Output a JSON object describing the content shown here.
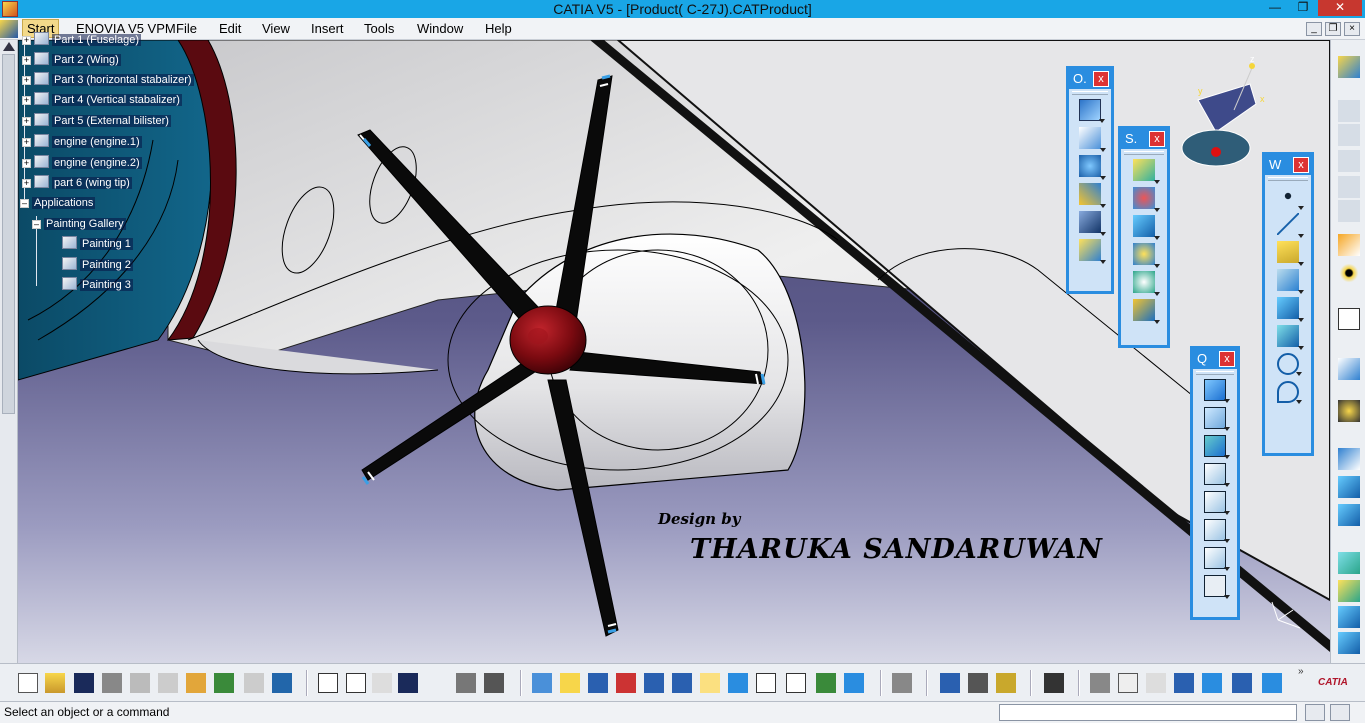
{
  "window": {
    "title": "CATIA V5 - [Product( C-27J).CATProduct]",
    "controls": [
      "minimize",
      "maximize",
      "close"
    ]
  },
  "menu": {
    "items": [
      "Start",
      "ENOVIA V5 VPM",
      "File",
      "Edit",
      "View",
      "Insert",
      "Tools",
      "Window",
      "Help"
    ]
  },
  "tree": {
    "nodes": [
      {
        "label": "Part 1 (Fuselage)",
        "icon": "part-icon"
      },
      {
        "label": "Part 2 (Wing)",
        "icon": "part-icon"
      },
      {
        "label": "Part 3 (horizontal stabalizer)",
        "icon": "part-icon"
      },
      {
        "label": "Part 4 (Vertical stabalizer)",
        "icon": "part-icon"
      },
      {
        "label": "Part 5  (External bilister)",
        "icon": "part-icon"
      },
      {
        "label": "engine (engine.1)",
        "icon": "product-icon"
      },
      {
        "label": "engine (engine.2)",
        "icon": "product-icon"
      },
      {
        "label": "part 6 (wing tip)",
        "icon": "part-icon"
      },
      {
        "label": "Applications",
        "icon": "applications-icon"
      },
      {
        "label": "Painting Gallery",
        "icon": "gallery-icon"
      },
      {
        "label": "Painting 1",
        "icon": "painting-icon"
      },
      {
        "label": "Painting 2",
        "icon": "painting-icon"
      },
      {
        "label": "Painting 3",
        "icon": "painting-icon"
      }
    ]
  },
  "viewport": {
    "watermark_line1": "Design by",
    "watermark_line2": "THARUKA SANDARUWAN",
    "compass_axes": [
      "x",
      "y",
      "z"
    ]
  },
  "panels": [
    {
      "id": "operations",
      "title": "O.",
      "close": "x"
    },
    {
      "id": "surfaces",
      "title": "S.",
      "close": "x"
    },
    {
      "id": "wireframe",
      "title": "W",
      "close": "x"
    },
    {
      "id": "quick-views",
      "title": "Q",
      "close": "x"
    }
  ],
  "status": {
    "message": "Select an object or a command",
    "command_input": ""
  },
  "colors": {
    "titlebar": "#19a6e6",
    "panel_border": "#2a8de0",
    "nacelle": "#e9e9ec",
    "spinner": "#7a0a10",
    "background": "#5c5a8a"
  }
}
